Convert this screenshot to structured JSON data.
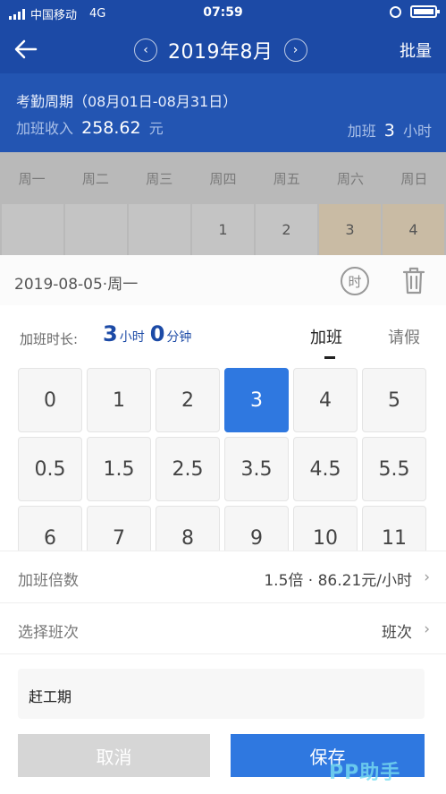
{
  "status_bar": {
    "carrier": "中国移动",
    "network": "4G",
    "time": "07:59"
  },
  "header": {
    "month": "2019年8月",
    "prev_icon": "‹",
    "next_icon": "›",
    "batch": "批量"
  },
  "summary": {
    "cycle": "考勤周期（08月01日-08月31日）",
    "income_label": "加班收入",
    "income_value": "258.62",
    "income_unit": "元",
    "ot_label": "加班",
    "ot_value": "3",
    "ot_unit": "小时"
  },
  "calendar": {
    "weekdays": [
      "周一",
      "周二",
      "周三",
      "周四",
      "周五",
      "周六",
      "周日"
    ],
    "first_row": [
      "",
      "",
      "",
      "1",
      "2",
      "3",
      "4"
    ]
  },
  "sheet": {
    "date": "2019-08-05·周一",
    "shift_icon_label": "时",
    "duration_label": "加班时长:",
    "duration_hours": "3",
    "hours_unit": "小时",
    "duration_minutes": "0",
    "minutes_unit": "分钟",
    "tab_overtime": "加班",
    "tab_leave": "请假",
    "hour_options": [
      "0",
      "1",
      "2",
      "3",
      "4",
      "5",
      "0.5",
      "1.5",
      "2.5",
      "3.5",
      "4.5",
      "5.5",
      "6",
      "7",
      "8",
      "9",
      "10",
      "11"
    ],
    "selected_option": "3",
    "rate_label": "加班倍数",
    "rate_value": "1.5倍 · 86.21元/小时",
    "shift_label": "选择班次",
    "shift_value": "班次",
    "note": "赶工期",
    "cancel": "取消",
    "save": "保存"
  },
  "watermark": "PP助手",
  "colors": {
    "primary": "#1c4aa6",
    "accent": "#2f78e0",
    "weekend": "#c9bba4"
  }
}
